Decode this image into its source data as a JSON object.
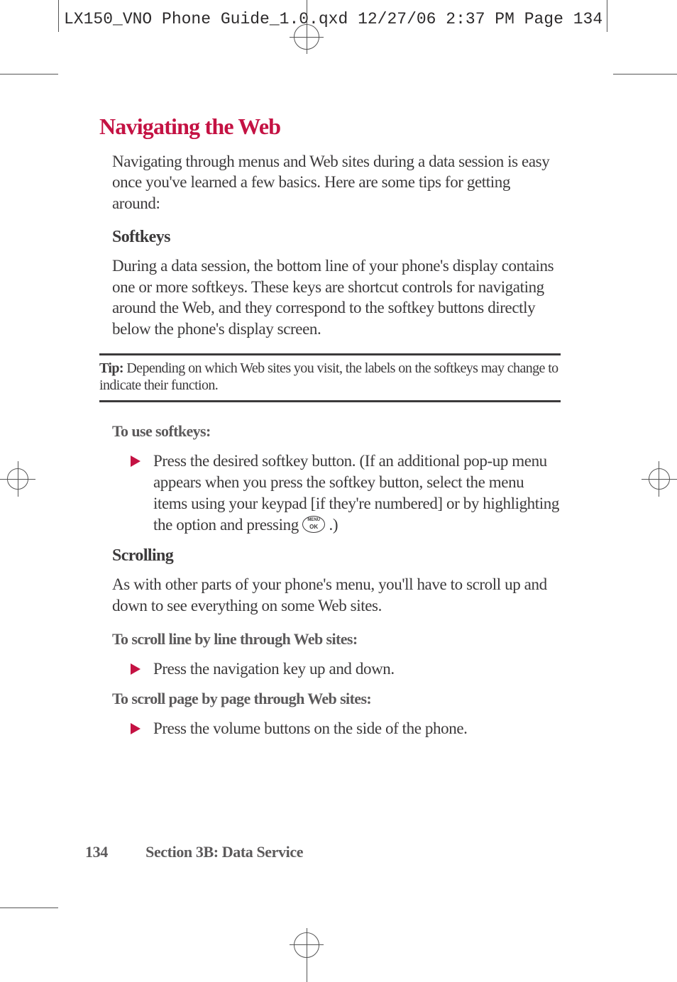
{
  "slug": "LX150_VNO Phone Guide_1.0.qxd  12/27/06  2:37 PM  Page 134",
  "heading": "Navigating the Web",
  "intro": "Navigating through menus and Web sites during a data session is easy once you've learned a few basics. Here are some tips for getting around:",
  "softkeys": {
    "title": "Softkeys",
    "body": "During a data session, the bottom line of your phone's display contains one or more softkeys. These keys are shortcut controls for navigating around the Web, and they correspond to the softkey buttons directly below the phone's display screen."
  },
  "tip": {
    "label": "Tip:",
    "text": " Depending on which Web sites you visit, the labels on the softkeys may change to indicate their function."
  },
  "use_softkeys": {
    "title": "To use softkeys:",
    "bullet_pre": "Press the desired softkey button. (If an additional pop-up menu appears when you press the softkey button, select the menu items using your keypad [if they're numbered] or by highlighting the option and pressing ",
    "bullet_post": " .)"
  },
  "scrolling": {
    "title": "Scrolling",
    "body": "As with other parts of your phone's menu, you'll have to scroll up and down to see everything on some Web sites."
  },
  "scroll_line": {
    "title": "To scroll line by line through Web sites:",
    "bullet": "Press the navigation key up and down."
  },
  "scroll_page": {
    "title": "To scroll page by page through Web sites:",
    "bullet": "Press the volume buttons on the side of the phone."
  },
  "footer": {
    "page": "134",
    "section": "Section 3B: Data Service"
  }
}
